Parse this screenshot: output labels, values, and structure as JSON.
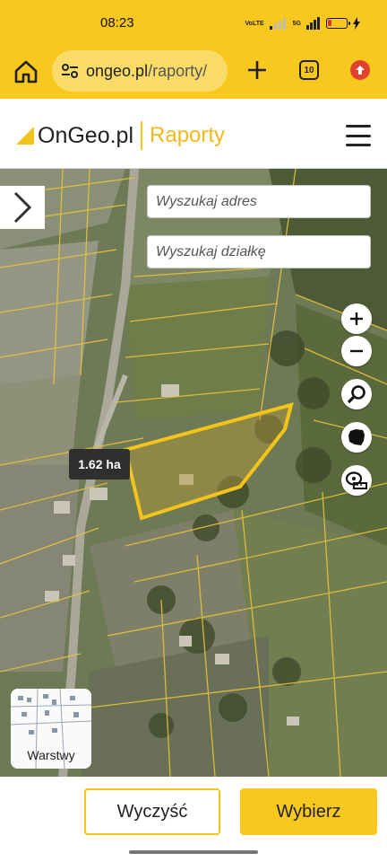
{
  "status_bar": {
    "time": "08:23",
    "volte_label": "VoLTE",
    "network_label": "5G",
    "battery_level": 0.2,
    "battery_color": "#d43a2a"
  },
  "browser": {
    "url_host": "ongeo.pl",
    "url_path": "/raporty/",
    "tab_count": "10",
    "accent_color": "#f8c81e"
  },
  "site": {
    "logo_text": "OnGeo.pl",
    "section_title": "Raporty",
    "accent_color": "#f5b81a"
  },
  "map": {
    "search_address_placeholder": "Wyszukaj adres",
    "search_parcel_placeholder": "Wyszukaj działkę",
    "area_label": "1.62 ha",
    "layers_label": "Warstwy",
    "parcel_outline_color": "#f5c41a",
    "controls": [
      "zoom-in-icon",
      "zoom-out-icon",
      "search-icon",
      "poland-map-icon",
      "measure-icon"
    ]
  },
  "actions": {
    "clear_label": "Wyczyść",
    "select_label": "Wybierz"
  }
}
